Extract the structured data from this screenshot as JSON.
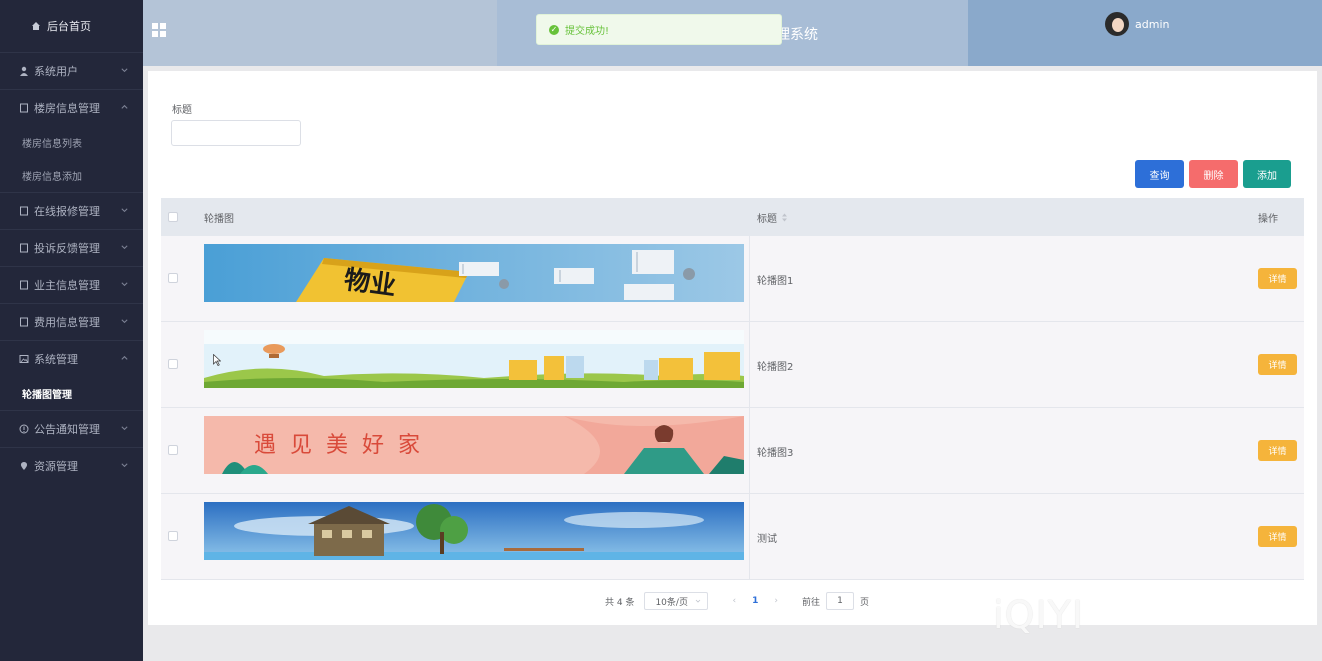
{
  "sidebar": {
    "home": "后台首页",
    "items": [
      {
        "label": "系统用户",
        "icon": "user-icon",
        "expanded": false
      },
      {
        "label": "楼房信息管理",
        "icon": "doc-icon",
        "expanded": true,
        "children": [
          "楼房信息列表",
          "楼房信息添加"
        ]
      },
      {
        "label": "在线报修管理",
        "icon": "doc-icon",
        "expanded": false
      },
      {
        "label": "投诉反馈管理",
        "icon": "doc-icon",
        "expanded": false
      },
      {
        "label": "业主信息管理",
        "icon": "doc-icon",
        "expanded": false
      },
      {
        "label": "费用信息管理",
        "icon": "doc-icon",
        "expanded": false
      },
      {
        "label": "系统管理",
        "icon": "picture-icon",
        "expanded": true,
        "children": [
          "轮播图管理"
        ]
      },
      {
        "label": "公告通知管理",
        "icon": "info-icon",
        "expanded": false
      },
      {
        "label": "资源管理",
        "icon": "location-icon",
        "expanded": false
      }
    ]
  },
  "header": {
    "title": "理系统",
    "user": "admin"
  },
  "toast": {
    "message": "提交成功!"
  },
  "search": {
    "title_label": "标题",
    "title_value": "",
    "query_button": "查询",
    "delete_button": "删除",
    "add_button": "添加"
  },
  "table": {
    "columns": [
      "轮播图",
      "标题",
      "操作"
    ],
    "rows": [
      {
        "title": "轮播图1",
        "action": "详情"
      },
      {
        "title": "轮播图2",
        "action": "详情"
      },
      {
        "title": "轮播图3",
        "action": "详情"
      },
      {
        "title": "测试",
        "action": "详情"
      }
    ]
  },
  "pagination": {
    "total": "共 4 条",
    "page_size": "10条/页",
    "current": "1",
    "goto_label": "前往",
    "goto_value": "1",
    "page_suffix": "页"
  },
  "banner_texts": {
    "banner1": "物业",
    "banner3": "遇见美好家"
  },
  "watermark": "iQIYI",
  "colors": {
    "sidebar_bg": "#23273a",
    "query": "#2d6fd8",
    "delete": "#f56c6c",
    "add": "#1a9e8f",
    "detail": "#f5b43b"
  }
}
